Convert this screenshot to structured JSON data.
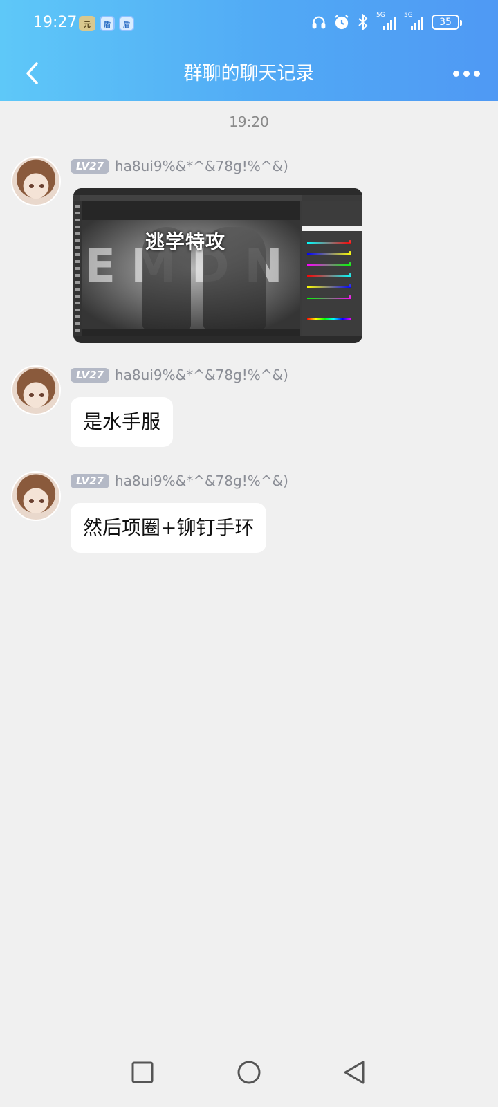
{
  "status_bar": {
    "time": "19:27",
    "app_badges": [
      "元",
      "盾",
      "盾"
    ],
    "network_1": "5G",
    "network_2": "5G",
    "battery": "35"
  },
  "nav": {
    "back_icon": "chevron-left-icon",
    "title": "群聊的聊天记录",
    "more_icon": "more-horizontal-icon"
  },
  "chat": {
    "timestamp": "19:20",
    "messages": [
      {
        "level": "LV27",
        "username": "ha8ui9%&*^&78g!%^&)",
        "type": "image",
        "image_overlay_text": "逃学特攻"
      },
      {
        "level": "LV27",
        "username": "ha8ui9%&*^&78g!%^&)",
        "type": "text",
        "text": "是水手服"
      },
      {
        "level": "LV27",
        "username": "ha8ui9%&*^&78g!%^&)",
        "type": "text",
        "text": "然后项圈+铆钉手环"
      }
    ]
  },
  "system_nav": {
    "recents_icon": "square-icon",
    "home_icon": "circle-icon",
    "back_icon": "triangle-back-icon"
  },
  "colors": {
    "header_gradient_start": "#5ec8f8",
    "header_gradient_end": "#4f99f4",
    "background": "#f0f0f0",
    "bubble": "#ffffff",
    "level_badge": "#b4b9c6"
  }
}
